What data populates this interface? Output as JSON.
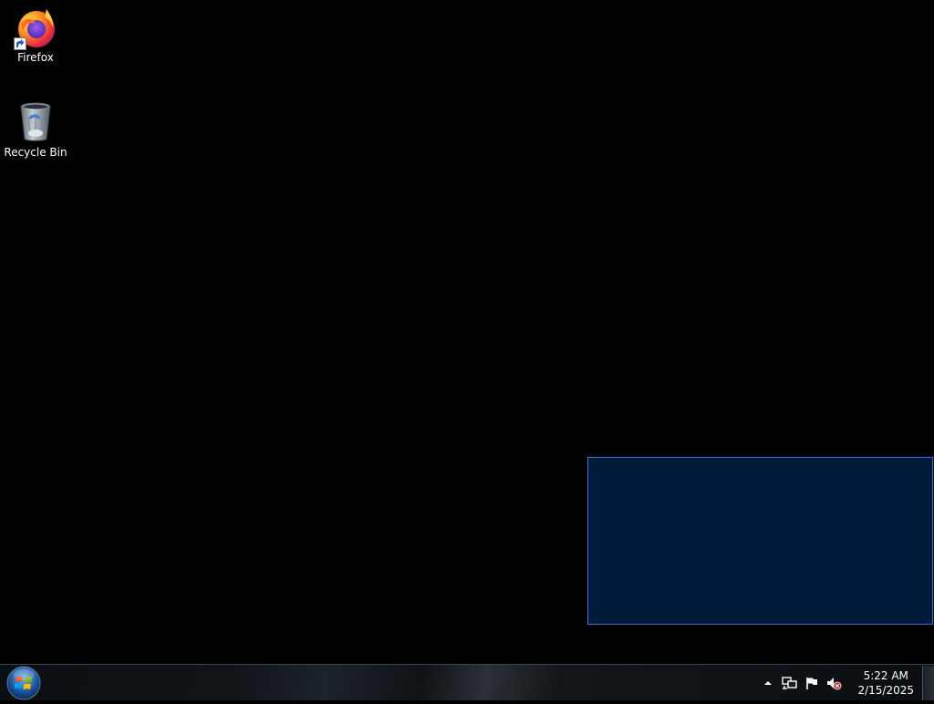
{
  "desktop": {
    "icons": [
      {
        "label": "Firefox",
        "icon": "firefox-icon",
        "shortcut": true
      },
      {
        "label": "Recycle Bin",
        "icon": "recycle-bin-icon",
        "shortcut": false
      }
    ],
    "selection_color": "#001a3a",
    "selection_border": "#3a6fd8"
  },
  "taskbar": {
    "start_icon": "windows-orb-icon",
    "tray_icons": [
      "show-hidden-icons-arrow-icon",
      "network-icon",
      "action-center-flag-icon",
      "volume-muted-icon"
    ],
    "clock": {
      "time": "5:22 AM",
      "date": "2/15/2025"
    }
  }
}
